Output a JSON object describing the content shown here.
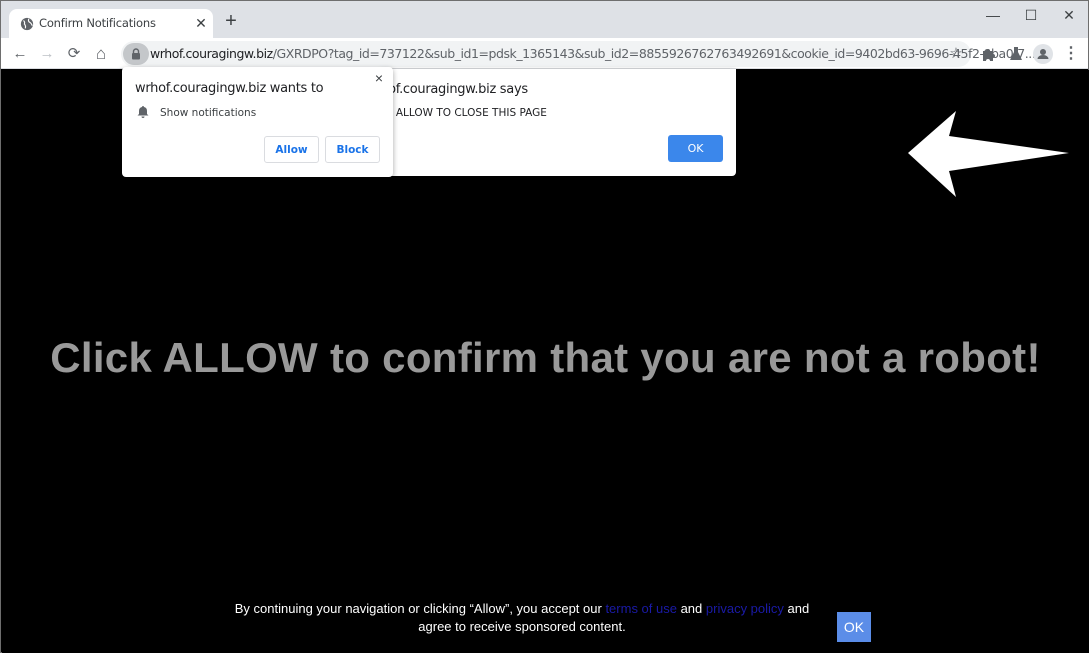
{
  "browser": {
    "tab": {
      "title": "Confirm Notifications",
      "icon": "globe-icon"
    },
    "new_tab_label": "+",
    "window_controls": {
      "minimize": "—",
      "maximize": "☐",
      "close": "✕"
    },
    "toolbar": {
      "back": "←",
      "forward": "→",
      "reload": "⟳",
      "home": "⌂",
      "url_host": "wrhof.couragingw.biz",
      "url_rest": "/GXRDPO?tag_id=737122&sub_id1=pdsk_1365143&sub_id2=8855926762763492691&cookie_id=9402bd63-9696-45f2-9ba0-7...",
      "bookmark": "☆",
      "menu": "⋮"
    }
  },
  "permission_prompt": {
    "title": "wrhof.couragingw.biz wants to",
    "permission_label": "Show notifications",
    "close": "×",
    "allow_label": "Allow",
    "block_label": "Block"
  },
  "alert_dialog": {
    "title": "wrhof.couragingw.biz says",
    "message": "CLICK ALLOW TO CLOSE THIS PAGE",
    "ok_label": "OK"
  },
  "page": {
    "headline": "Click ALLOW to confirm that you are not a robot!",
    "consent": {
      "text_before": "By continuing your navigation or clicking “Allow”, you accept our ",
      "terms_link": "terms of use",
      "text_and": " and ",
      "privacy_link": "privacy policy",
      "text_after": " and agree to receive sponsored content."
    },
    "consent_ok_label": "OK",
    "colors": {
      "background": "#000000",
      "headline": "#999999",
      "link": "#1a1aa6",
      "ok_button": "#5b8de8",
      "chrome_accent": "#1a73e8"
    }
  }
}
